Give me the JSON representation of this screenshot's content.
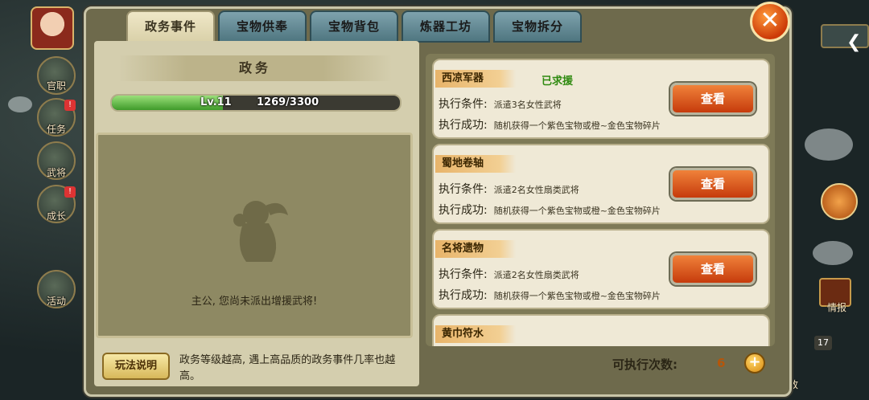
{
  "sidebar": {
    "items": [
      {
        "label": "官职",
        "badge": ""
      },
      {
        "label": "任务",
        "badge": "!"
      },
      {
        "label": "武将",
        "badge": ""
      },
      {
        "label": "成长",
        "badge": "!"
      },
      {
        "label": "活动",
        "badge": ""
      }
    ]
  },
  "right_side": {
    "report_label": "情报",
    "badge_count": "17",
    "bottom_label": "政"
  },
  "tabs": [
    {
      "label": "政务事件",
      "active": true
    },
    {
      "label": "宝物供奉",
      "active": false
    },
    {
      "label": "宝物背包",
      "active": false
    },
    {
      "label": "炼器工坊",
      "active": false
    },
    {
      "label": "宝物拆分",
      "active": false
    }
  ],
  "close_icon": "x-icon",
  "left_panel": {
    "title": "政务",
    "level": "Lv.11",
    "exp": "1269/3300",
    "exp_fraction": 0.3845,
    "dispatch_message": "主公, 您尚未派出增援武将!",
    "rules_button": "玩法说明",
    "rules_text": "政务等级越高, 遇上高品质的政务事件几率也越高。"
  },
  "events": [
    {
      "title": "西凉军器",
      "status": "已求援",
      "cond_label": "执行条件:",
      "cond_value": "派遣3名女性武将",
      "reward_label": "执行成功:",
      "reward_value": "随机获得一个紫色宝物或橙~金色宝物碎片",
      "button": "查看"
    },
    {
      "title": "蜀地卷轴",
      "status": "",
      "cond_label": "执行条件:",
      "cond_value": "派遣2名女性扇类武将",
      "reward_label": "执行成功:",
      "reward_value": "随机获得一个紫色宝物或橙~金色宝物碎片",
      "button": "查看"
    },
    {
      "title": "名将遗物",
      "status": "",
      "cond_label": "执行条件:",
      "cond_value": "派遣2名女性扇类武将",
      "reward_label": "执行成功:",
      "reward_value": "随机获得一个紫色宝物或橙~金色宝物碎片",
      "button": "查看"
    },
    {
      "title": "黄巾符水",
      "status": "",
      "cond_label": "",
      "cond_value": "",
      "reward_label": "",
      "reward_value": "",
      "button": ""
    }
  ],
  "footer": {
    "exec_label": "可执行次数:",
    "exec_count": "6",
    "plus_icon": "plus-icon"
  },
  "colors": {
    "panel": "#6e6a4c",
    "tab_active": "#efe7c7",
    "tab_inactive": "#5f8791",
    "button_orange": "#e0622a",
    "status_green": "#2f8a10"
  }
}
